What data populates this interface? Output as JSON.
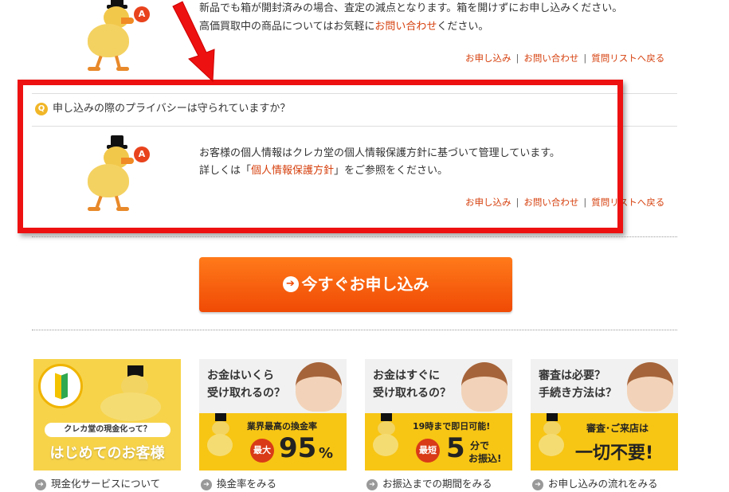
{
  "faq_previous": {
    "answer_line1": "新品でも箱が開封済みの場合、査定の減点となります。箱を開けずにお申し込みください。",
    "answer_line2_prefix": "高価買取中の商品についてはお気軽に",
    "answer_line2_link": "お問い合わせ",
    "answer_line2_suffix": "ください。",
    "bubble_letter": "A"
  },
  "faq_links": {
    "apply": "お申し込み",
    "contact": "お問い合わせ",
    "back": "質問リストへ戻る",
    "sep": "|"
  },
  "faq_current": {
    "q_letter": "Q",
    "question": "申し込みの際のプライバシーは守られていますか？",
    "answer_line1": "お客様の個人情報はクレカ堂の個人情報保護方針に基づいて管理しています。",
    "answer_line2_prefix": "詳しくは「",
    "answer_line2_link": "個人情報保護方針",
    "answer_line2_suffix": "」をご参照をください。",
    "bubble_letter": "A"
  },
  "cta": {
    "arrow": "➔",
    "label": "今すぐお申し込み"
  },
  "banners": [
    {
      "tag": "クレカ堂の現金化って？",
      "headline": "はじめてのお客様",
      "link": "現金化サービスについて"
    },
    {
      "question": "お金はいくら\n受け取れるの？",
      "top": "業界最高の換金率",
      "pill": "最大",
      "big": "95",
      "unit": "%",
      "link": "換金率をみる"
    },
    {
      "question": "お金はすぐに\n受け取れるの？",
      "top": "19時まで即日可能!",
      "pill": "最短",
      "big": "5",
      "unit_line1": "分で",
      "unit_line2": "お振込!",
      "link": "お振込までの期間をみる"
    },
    {
      "question": "審査は必要？\n手続き方法は？",
      "top": "審査･ご来店は",
      "big": "一切不要!",
      "link": "お申し込みの流れをみる"
    }
  ],
  "colors": {
    "accent": "#d6410f",
    "frame": "#ee1111",
    "cta": "#f04a05",
    "banner_yellow": "#f7c514"
  }
}
